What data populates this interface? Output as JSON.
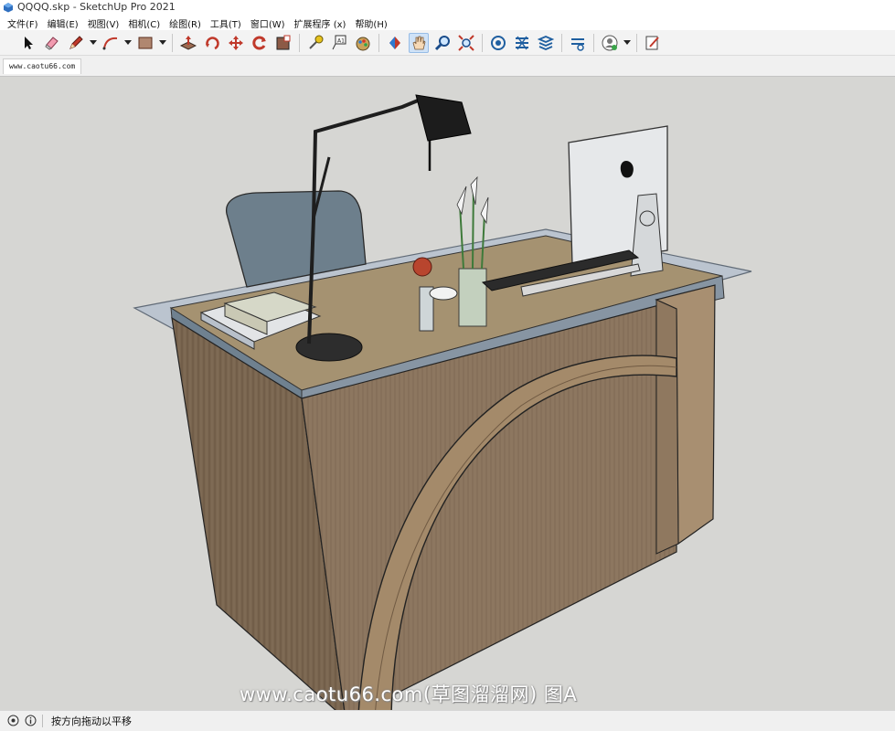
{
  "window": {
    "title": "QQQQ.skp - SketchUp Pro 2021"
  },
  "menu": {
    "items": [
      "文件(F)",
      "编辑(E)",
      "视图(V)",
      "相机(C)",
      "绘图(R)",
      "工具(T)",
      "窗口(W)",
      "扩展程序 (x)",
      "帮助(H)"
    ]
  },
  "toolbar": {
    "tools": [
      "select-tool",
      "eraser-tool",
      "pencil-tool",
      "arc-tool",
      "rectangle-tool",
      "push-pull-tool",
      "rotate-tool",
      "move-tool",
      "follow-me-tool",
      "scale-tool",
      "tape-measure-tool",
      "text-tool",
      "paint-bucket-tool",
      "orbit-tool",
      "pan-tool",
      "zoom-tool",
      "zoom-extents-tool",
      "3d-warehouse-tool",
      "extension-warehouse-tool",
      "layout-tool",
      "extension-manager-tool",
      "account-tool",
      "send-to-layout-tool"
    ],
    "active_tool": "pan-tool"
  },
  "scene": {
    "tab_label": "www.caotu66.com"
  },
  "viewport": {
    "background_color": "#d6d6d3",
    "watermark": "www.caotu66.com(草图溜溜网) 图A"
  },
  "status": {
    "text": "按方向拖动以平移"
  }
}
